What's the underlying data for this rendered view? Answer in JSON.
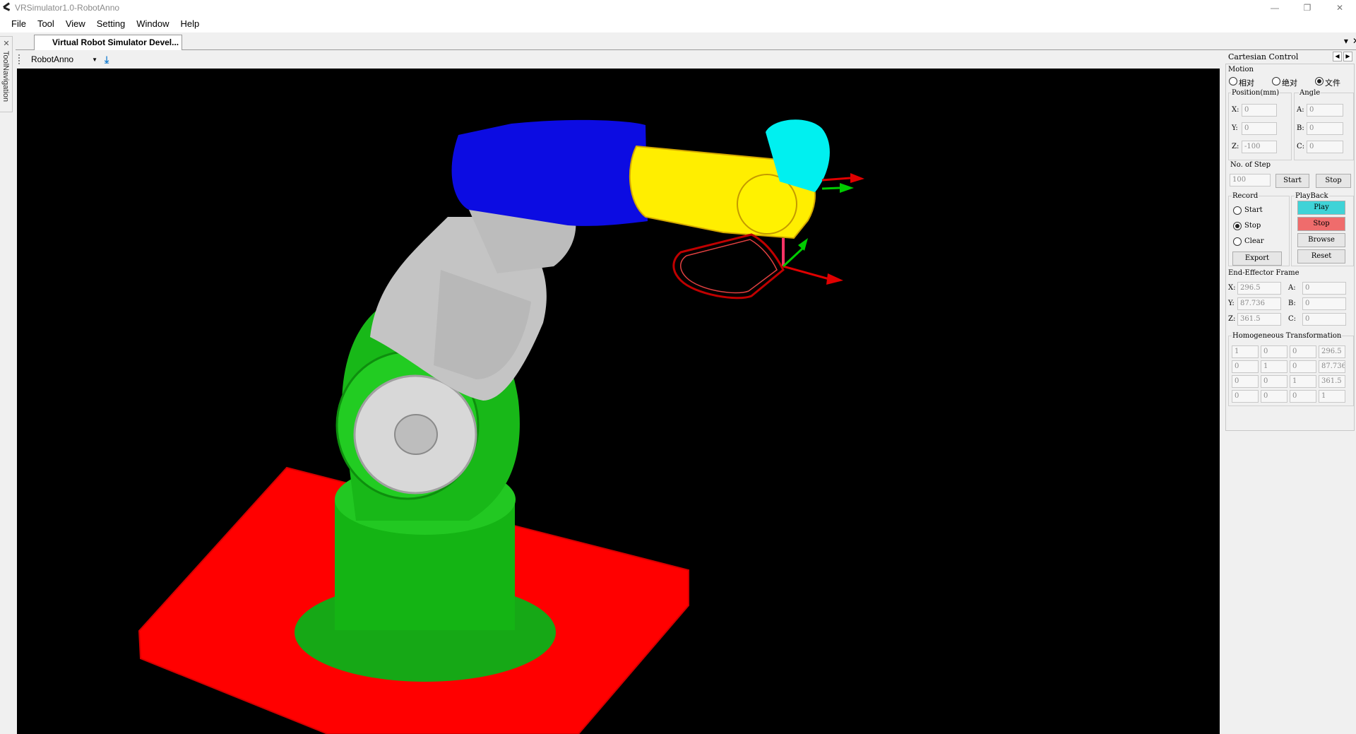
{
  "window": {
    "title": "VRSimulator1.0-RobotAnno",
    "minimize": "—",
    "restore": "❐",
    "close": "✕"
  },
  "menu": [
    "File",
    "Tool",
    "View",
    "Setting",
    "Window",
    "Help"
  ],
  "left_panel": {
    "label": "ToolNavigation"
  },
  "doc_tab": {
    "title": "Virtual Robot Simulator Devel...",
    "menu_glyph": "▾",
    "close_glyph": "✕"
  },
  "toolbar": {
    "robot_select": "RobotAnno"
  },
  "panel": {
    "title": "Cartesian Control",
    "motion": {
      "label": "Motion",
      "options": [
        {
          "label": "相对",
          "checked": false
        },
        {
          "label": "绝对",
          "checked": false
        },
        {
          "label": "文件",
          "checked": true
        }
      ]
    },
    "position": {
      "label": "Position(mm)",
      "x_label": "X:",
      "y_label": "Y:",
      "z_label": "Z:",
      "x": "0",
      "y": "0",
      "z": "-100"
    },
    "angle": {
      "label": "Angle",
      "a_label": "A:",
      "b_label": "B:",
      "c_label": "C:",
      "a": "0",
      "b": "0",
      "c": "0"
    },
    "steps": {
      "label": "No. of Step",
      "value": "100",
      "start": "Start",
      "stop": "Stop"
    },
    "record": {
      "label": "Record",
      "options": [
        {
          "label": "Start",
          "checked": false
        },
        {
          "label": "Stop",
          "checked": true
        },
        {
          "label": "Clear",
          "checked": false
        }
      ],
      "export": "Export"
    },
    "playback": {
      "label": "PlayBack",
      "play": "Play",
      "stop": "Stop",
      "browse": "Browse",
      "reset": "Reset"
    },
    "end_effector": {
      "label": "End-Effector Frame",
      "x_label": "X:",
      "y_label": "Y:",
      "z_label": "Z:",
      "a_label": "A:",
      "b_label": "B:",
      "c_label": "C:",
      "x": "296.5",
      "y": "87.736",
      "z": "361.5",
      "a": "0",
      "b": "0",
      "c": "0"
    },
    "homogeneous": {
      "label": "Homogeneous Transformation",
      "matrix": [
        [
          "1",
          "0",
          "0",
          "296.5"
        ],
        [
          "0",
          "1",
          "0",
          "87.736"
        ],
        [
          "0",
          "0",
          "1",
          "361.5"
        ],
        [
          "0",
          "0",
          "0",
          "1"
        ]
      ]
    }
  },
  "colors": {
    "base_plate": "#ff0000",
    "base": "#16b416",
    "upper_arm": "#c8c8c8",
    "shoulder": "#0a0ae0",
    "forearm": "#ffee00",
    "tool": "#00f0f0",
    "play": "#3fd3d7",
    "stop": "#ef6c6c"
  }
}
